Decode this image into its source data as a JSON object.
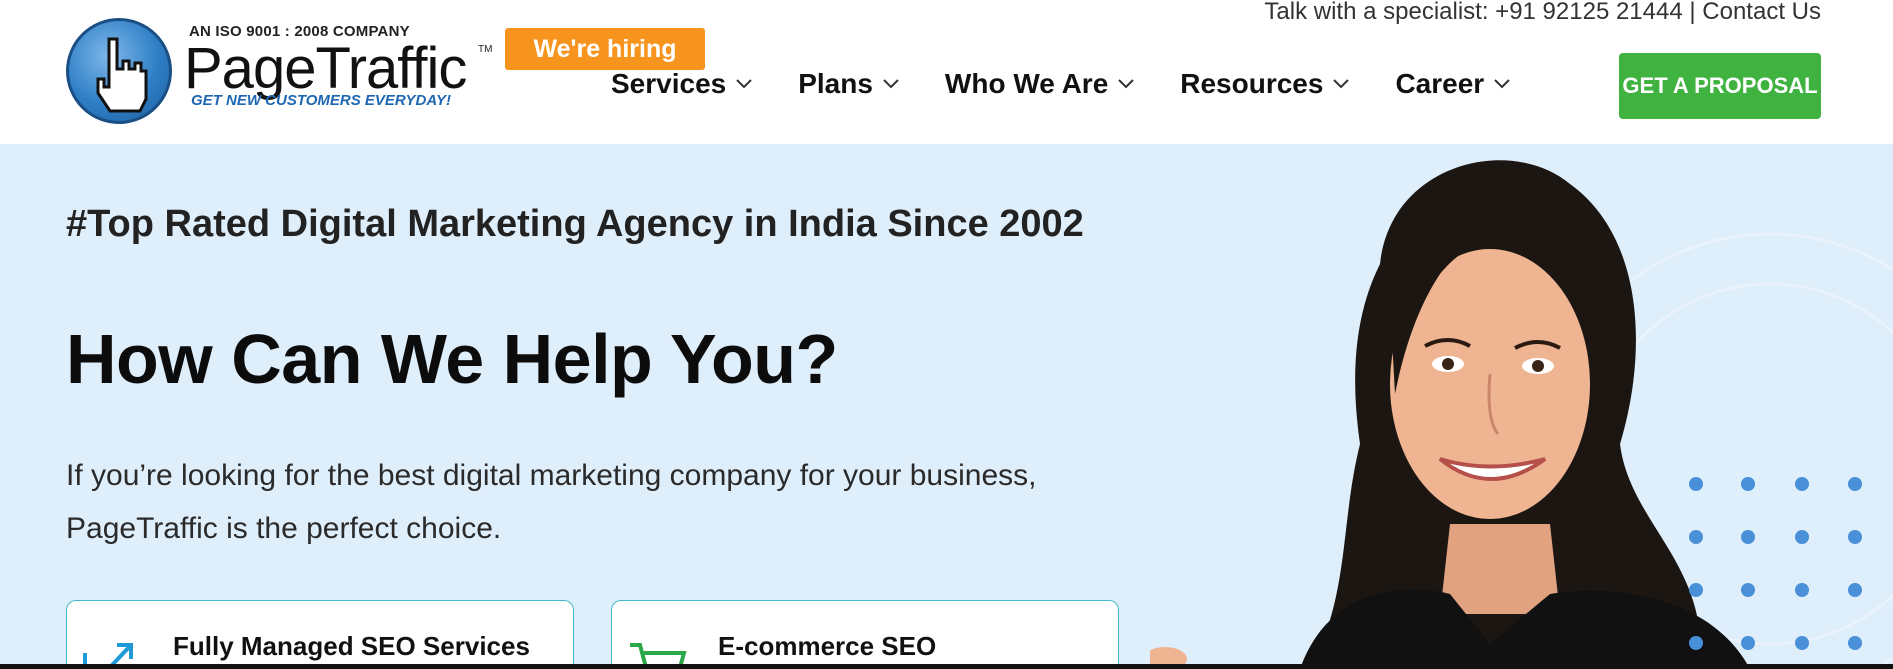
{
  "header": {
    "logo": {
      "iso_text": "AN ISO 9001 : 2008 COMPANY",
      "brand": "PageTraffic",
      "trademark": "TM",
      "tagline": "GET NEW CUSTOMERS EVERYDAY!"
    },
    "hiring_badge": "We're hiring",
    "topbar": {
      "specialist": "Talk with a specialist: +91 92125 21444",
      "separator": "|",
      "contact": "Contact Us"
    },
    "nav": [
      {
        "label": "Services"
      },
      {
        "label": "Plans"
      },
      {
        "label": "Who We Are"
      },
      {
        "label": "Resources"
      },
      {
        "label": "Career"
      }
    ],
    "cta": "GET A PROPOSAL"
  },
  "hero": {
    "tagline": "#Top Rated Digital Marketing Agency in India Since 2002",
    "headline": "How Can We Help You?",
    "intro": "If you’re looking for the best digital marketing company for your business, PageTraffic is the perfect choice.",
    "cards": [
      {
        "title": "Fully Managed SEO Services"
      },
      {
        "title": "E-commerce SEO"
      }
    ]
  },
  "colors": {
    "hero_bg": "#dfeefb",
    "hiring": "#f7941d",
    "cta": "#3fb23f",
    "card_border": "#45b7c8",
    "dots": "#4a90d9"
  }
}
